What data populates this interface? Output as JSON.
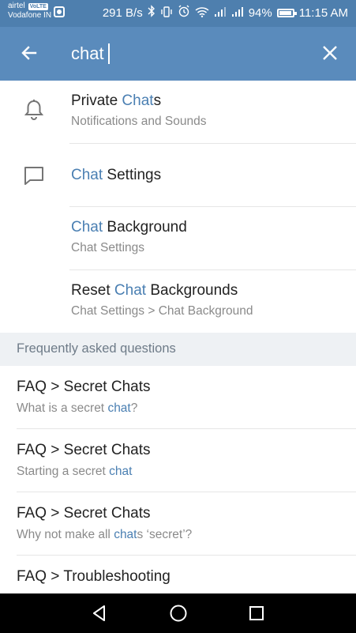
{
  "status_bar": {
    "carrier1": "airtel",
    "carrier1_badge": "VoLTE",
    "carrier2": "Vodafone IN",
    "speed": "291 B/s",
    "battery": "94%",
    "time": "11:15 AM",
    "icons": [
      "bluetooth-icon",
      "vibrate-icon",
      "alarm-icon",
      "wifi-icon",
      "signal-icon",
      "signal-icon",
      "battery-icon"
    ]
  },
  "search": {
    "value": "chat",
    "back_icon": "arrow-left-icon",
    "clear_icon": "close-icon"
  },
  "results": [
    {
      "icon": "bell-icon",
      "title_parts": [
        "Private ",
        "Chat",
        "s"
      ],
      "subtitle": "Notifications and Sounds"
    },
    {
      "icon": "chat-bubble-icon",
      "title_parts": [
        "",
        "Chat",
        " Settings"
      ],
      "subtitle": ""
    },
    {
      "icon": "",
      "title_parts": [
        "",
        "Chat",
        " Background"
      ],
      "subtitle": "Chat Settings"
    },
    {
      "icon": "",
      "title_parts": [
        "Reset ",
        "Chat",
        " Backgrounds"
      ],
      "subtitle": "Chat Settings > Chat Background"
    }
  ],
  "faq": {
    "header": "Frequently asked questions",
    "items": [
      {
        "title": "FAQ > Secret Chats",
        "sub_parts": [
          "What is a secret ",
          "chat",
          "?"
        ]
      },
      {
        "title": "FAQ > Secret Chats",
        "sub_parts": [
          "Starting a secret ",
          "chat",
          ""
        ]
      },
      {
        "title": "FAQ > Secret Chats",
        "sub_parts": [
          "Why not make all ",
          "chat",
          "s ‘secret’?"
        ]
      },
      {
        "title": "FAQ > Troubleshooting",
        "sub_parts": [
          "",
          "",
          ""
        ]
      }
    ]
  },
  "colors": {
    "status_bar": "#4e7fae",
    "app_bar": "#5a8bbc",
    "highlight": "#4a7fb2",
    "faq_header_bg": "#eef1f4"
  },
  "nav": {
    "icons": [
      "back-triangle-icon",
      "home-circle-icon",
      "recents-square-icon"
    ]
  }
}
